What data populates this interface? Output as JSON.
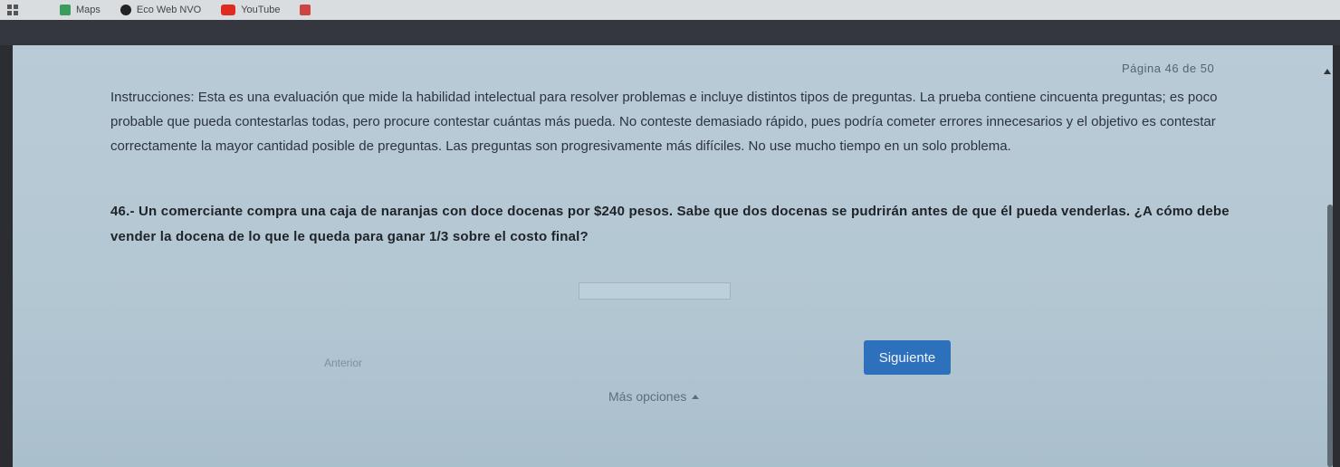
{
  "bookmarks": [
    {
      "label": "",
      "icon": "apps-grid-icon"
    },
    {
      "label": "Maps",
      "icon": "maps-icon"
    },
    {
      "label": "Eco Web NVO",
      "icon": "globe-icon"
    },
    {
      "label": "YouTube",
      "icon": "youtube-icon"
    },
    {
      "label": "",
      "icon": "mail-icon"
    }
  ],
  "page_indicator": "Página 46 de 50",
  "instructions": "Instrucciones: Esta es una evaluación que mide la habilidad intelectual para resolver problemas e incluye distintos tipos de preguntas. La prueba contiene cincuenta preguntas; es poco probable que pueda contestarlas todas, pero procure contestar cuántas más pueda. No conteste demasiado rápido, pues podría cometer errores innecesarios y el objetivo es contestar correctamente la mayor cantidad posible de preguntas. Las preguntas son progresivamente más difíciles. No use mucho tiempo en un solo problema.",
  "question": "46.- Un comerciante compra una caja de naranjas con doce docenas por $240 pesos. Sabe que dos docenas se pudrirán antes de que él pueda venderlas. ¿A cómo debe vender la docena de lo que le queda para ganar 1/3 sobre el costo final?",
  "answer": {
    "value": "",
    "placeholder": ""
  },
  "nav": {
    "prev_label": "Anterior",
    "next_label": "Siguiente",
    "more_label": "Más opciones"
  },
  "colors": {
    "accent": "#2d71bd",
    "page_bg": "#b9cbd6"
  }
}
